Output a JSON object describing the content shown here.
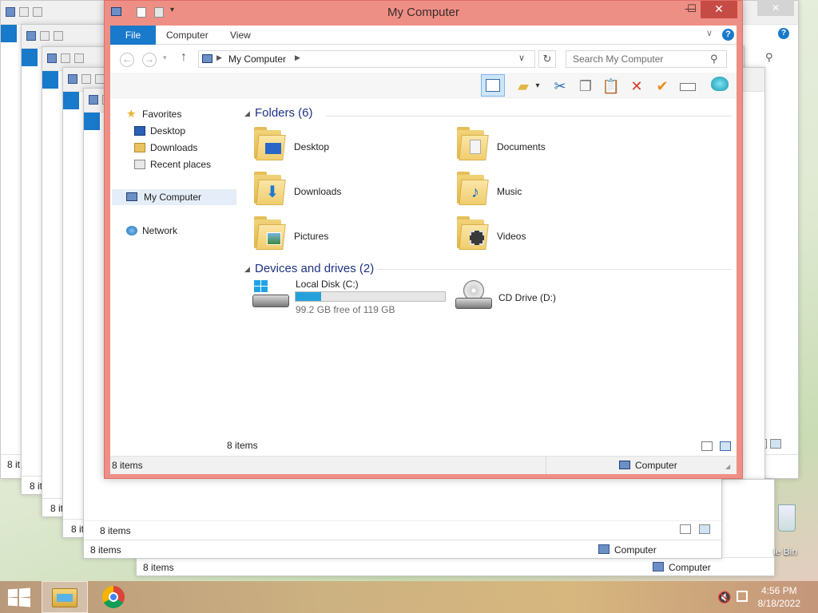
{
  "window": {
    "title": "My Computer",
    "minimize": "—",
    "maximize": "☐",
    "close": "✕"
  },
  "ribbon": {
    "tabs": [
      "File",
      "Computer",
      "View"
    ],
    "help": "?"
  },
  "address": {
    "path": "My Computer",
    "search_placeholder": "Search My Computer"
  },
  "nav": {
    "favorites_label": "Favorites",
    "favorites": [
      "Desktop",
      "Downloads",
      "Recent places"
    ],
    "computer": "My Computer",
    "network": "Network"
  },
  "content": {
    "folders_header": "Folders (6)",
    "folders": [
      "Desktop",
      "Documents",
      "Downloads",
      "Music",
      "Pictures",
      "Videos"
    ],
    "drives_header": "Devices and drives (2)",
    "drives": [
      {
        "name": "Local Disk (C:)",
        "free": "99.2 GB free of 119 GB",
        "used_fraction": 0.17
      },
      {
        "name": "CD Drive (D:)"
      }
    ]
  },
  "status": {
    "items_top": "8 items",
    "items_bottom": "8 items",
    "location": "Computer"
  },
  "background_windows": {
    "items_label": "8 items",
    "items_short": "8 it",
    "location": "Computer"
  },
  "desktop": {
    "recycle_label": "le Bin"
  },
  "taskbar": {
    "time": "4:56 PM",
    "date": "8/18/2022"
  },
  "colors": {
    "accent": "#1979ca",
    "title_bar": "#ee8f86",
    "group_header": "#1e3287",
    "disk_fill": "#26a0da"
  }
}
